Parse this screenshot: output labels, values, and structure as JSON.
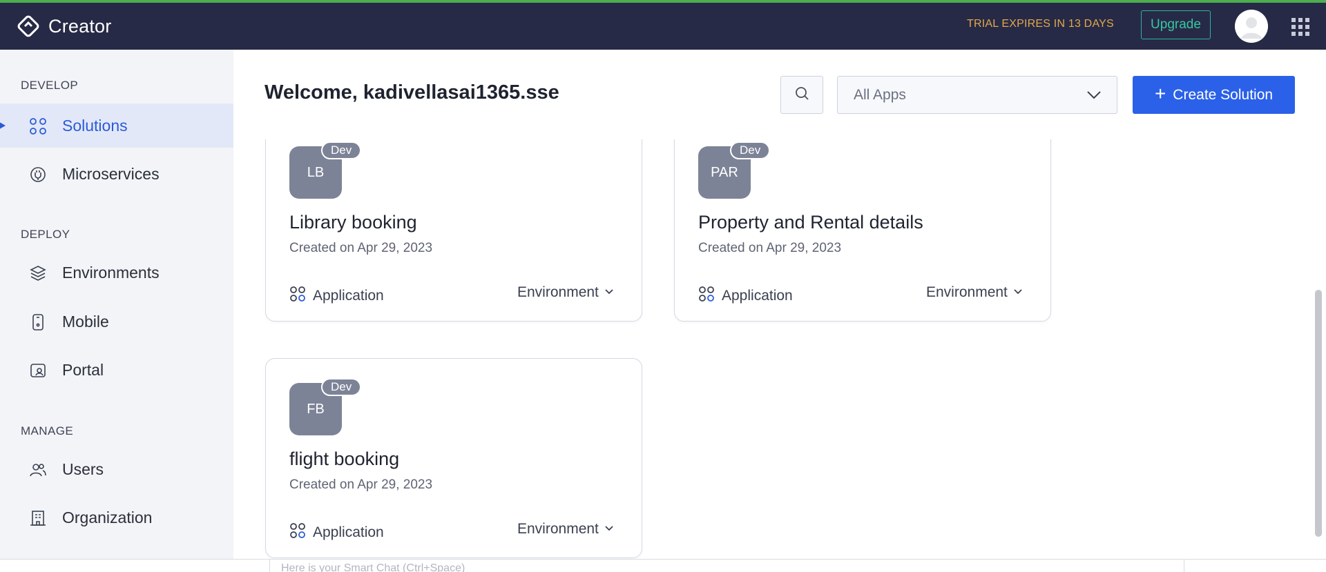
{
  "app": {
    "name": "Creator"
  },
  "header": {
    "trial_text": "TRIAL EXPIRES IN 13 DAYS",
    "upgrade_label": "Upgrade",
    "icons": [
      "creator-logo-icon",
      "avatar",
      "apps-grid-icon"
    ]
  },
  "sidebar": {
    "sections": [
      {
        "label": "DEVELOP"
      },
      {
        "label": "DEPLOY"
      },
      {
        "label": "MANAGE"
      }
    ],
    "items": [
      {
        "label": "Solutions",
        "icon": "solutions-icon",
        "active": true
      },
      {
        "label": "Microservices",
        "icon": "microservices-icon"
      },
      {
        "label": "Environments",
        "icon": "environments-icon"
      },
      {
        "label": "Mobile",
        "icon": "mobile-icon"
      },
      {
        "label": "Portal",
        "icon": "portal-icon"
      },
      {
        "label": "Users",
        "icon": "users-icon"
      },
      {
        "label": "Organization",
        "icon": "organization-icon"
      }
    ],
    "accent_color": "#2a5bd7"
  },
  "main": {
    "welcome": "Welcome, kadivellasai1365.sse",
    "filter": {
      "selected": "All Apps"
    },
    "create_label": "Create Solution",
    "create_color": "#2b61e8"
  },
  "cards": [
    {
      "initials": "LB",
      "badge": "Dev",
      "title": "Library booking",
      "created": "Created on Apr 29, 2023",
      "type": "Application",
      "env": "Environment"
    },
    {
      "initials": "PAR",
      "badge": "Dev",
      "title": "Property and Rental details",
      "created": "Created on Apr 29, 2023",
      "type": "Application",
      "env": "Environment"
    },
    {
      "initials": "FB",
      "badge": "Dev",
      "title": "flight booking",
      "created": "Created on Apr 29, 2023",
      "type": "Application",
      "env": "Environment"
    }
  ],
  "chat": {
    "placeholder": "Here is your Smart Chat (Ctrl+Space)"
  }
}
